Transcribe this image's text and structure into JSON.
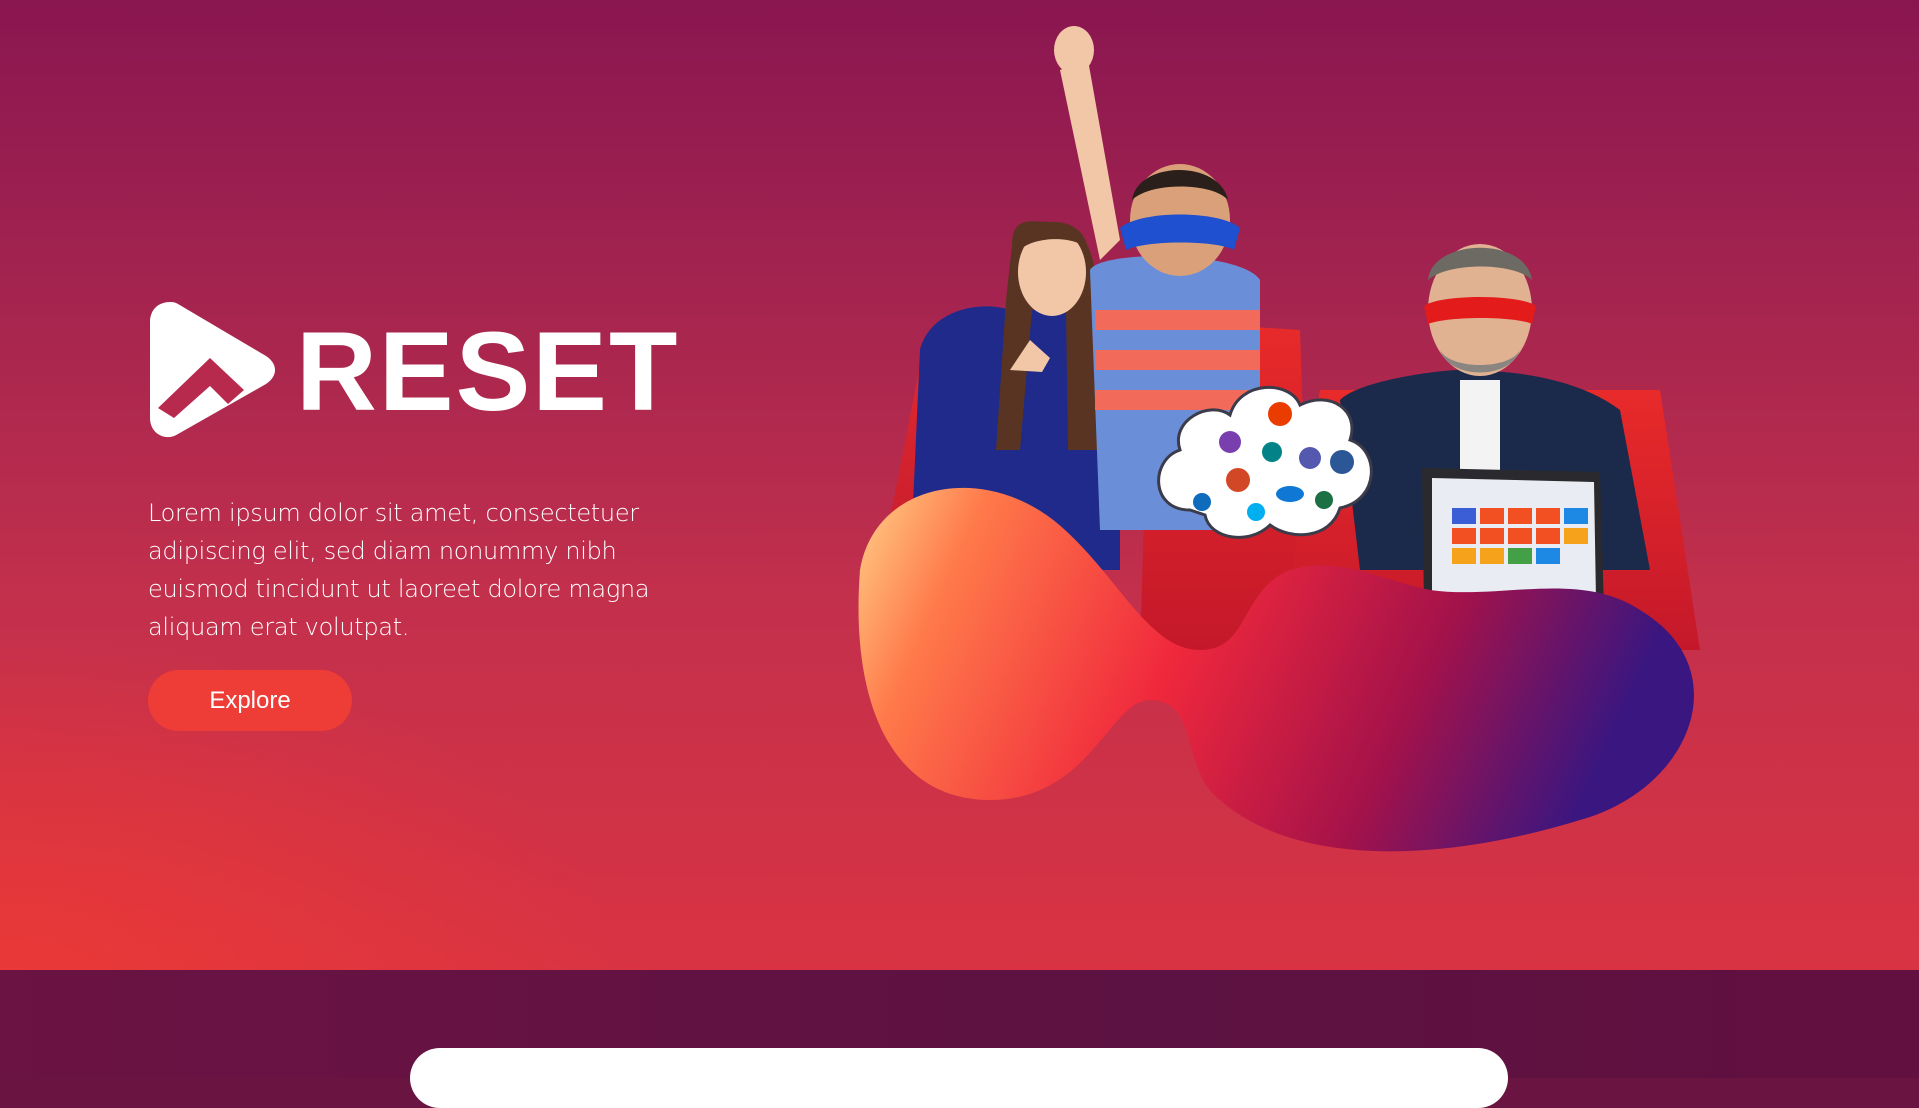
{
  "brand": {
    "name": "RESET",
    "logo_icon": "play-arrow-logo-icon",
    "text_color": "#ffffff"
  },
  "hero": {
    "description": "Lorem ipsum dolor sit amet, consectetuer adipiscing elit, sed diam nonummy nibh euismod tincidunt ut laoreet dolore magna aliquam erat volutpat.",
    "explore_label": "Explore",
    "button_color": "#ee3c36",
    "background_top": "#8a1650",
    "background_bottom": "#d93343",
    "illustration": "three-people-in-superhero-capes-with-office-app-cloud-and-laptop",
    "cloud_icons": [
      "onenote-icon",
      "office-icon",
      "sharepoint-icon",
      "teams-icon",
      "word-icon",
      "powerpoint-icon",
      "outlook-icon",
      "skype-icon",
      "onedrive-icon",
      "excel-icon"
    ]
  },
  "band": {
    "color": "#6b1343"
  }
}
